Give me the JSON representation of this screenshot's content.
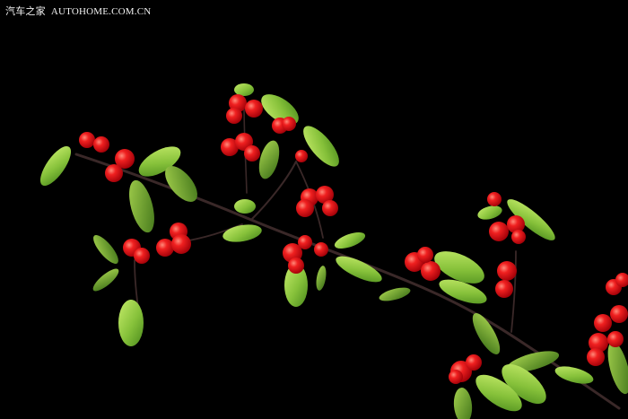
{
  "watermark": {
    "brand": "汽车之家",
    "site": "AUTOHOME.COM.CN"
  },
  "colors": {
    "background": "#000000",
    "berry": "#e8141c",
    "berry_highlight": "#ff6a5a",
    "leaf": "#8cc63f",
    "leaf_dark": "#4f8a1e",
    "stem": "#3b2a2a"
  }
}
